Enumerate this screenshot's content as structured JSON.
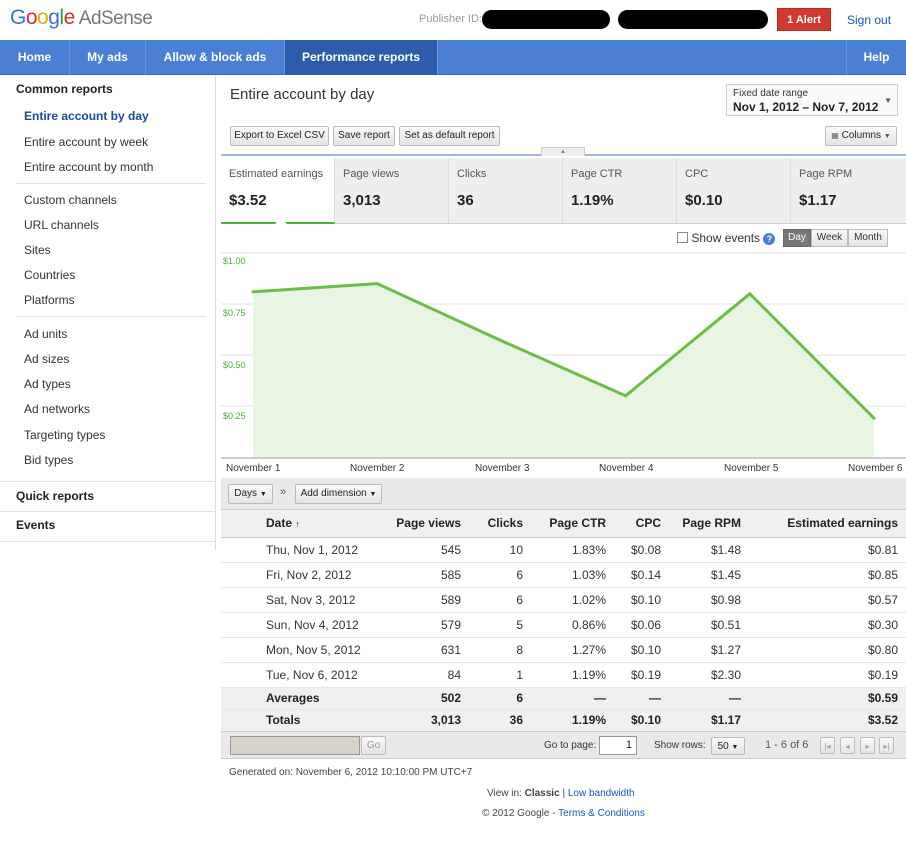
{
  "header": {
    "logo_letters": [
      "G",
      "o",
      "o",
      "g",
      "l",
      "e"
    ],
    "product": "AdSense",
    "publisher_label": "Publisher ID:",
    "alert_label": "1 Alert",
    "signout_label": "Sign out"
  },
  "nav": {
    "items": [
      {
        "label": "Home"
      },
      {
        "label": "My ads"
      },
      {
        "label": "Allow & block ads"
      },
      {
        "label": "Performance reports"
      }
    ],
    "help_label": "Help"
  },
  "sidebar": {
    "common_heading": "Common reports",
    "common_items": [
      "Entire account by day",
      "Entire account by week",
      "Entire account by month"
    ],
    "group2": [
      "Custom channels",
      "URL channels",
      "Sites",
      "Countries",
      "Platforms"
    ],
    "group3": [
      "Ad units",
      "Ad sizes",
      "Ad types",
      "Ad networks",
      "Targeting types",
      "Bid types"
    ],
    "quick_reports": "Quick reports",
    "events": "Events"
  },
  "report": {
    "title": "Entire account by day",
    "date_range_label": "Fixed date range",
    "date_range_value": "Nov 1, 2012 – Nov 7, 2012",
    "buttons": {
      "export": "Export to Excel CSV",
      "save": "Save report",
      "default": "Set as default report",
      "columns": "Columns"
    }
  },
  "metrics": [
    {
      "label": "Estimated earnings",
      "value": "$3.52"
    },
    {
      "label": "Page views",
      "value": "3,013"
    },
    {
      "label": "Clicks",
      "value": "36"
    },
    {
      "label": "Page CTR",
      "value": "1.19%"
    },
    {
      "label": "CPC",
      "value": "$0.10"
    },
    {
      "label": "Page RPM",
      "value": "$1.17"
    }
  ],
  "chart_controls": {
    "show_events": "Show events",
    "help_icon": "?",
    "granularity": [
      "Day",
      "Week",
      "Month"
    ],
    "active_granularity": "Day"
  },
  "chart_data": {
    "type": "area",
    "x": [
      "November 1",
      "November 2",
      "November 3",
      "November 4",
      "November 5",
      "November 6"
    ],
    "y_ticks": [
      "$1.00",
      "$0.75",
      "$0.50",
      "$0.25"
    ],
    "ylim": [
      0,
      1.0
    ],
    "series": [
      {
        "values": [
          0.81,
          0.85,
          0.57,
          0.3,
          0.8,
          0.19
        ]
      }
    ],
    "line_color": "#6cbd45",
    "fill_color": "#e9f5e3"
  },
  "dimension_bar": {
    "dimension": "Days",
    "separator": "»",
    "add_dimension": "Add dimension"
  },
  "table": {
    "columns": [
      "Date",
      "Page views",
      "Clicks",
      "Page CTR",
      "CPC",
      "Page RPM",
      "Estimated earnings"
    ],
    "sort_indicator": "↑",
    "rows": [
      [
        "Thu, Nov 1, 2012",
        "545",
        "10",
        "1.83%",
        "$0.08",
        "$1.48",
        "$0.81"
      ],
      [
        "Fri, Nov 2, 2012",
        "585",
        "6",
        "1.03%",
        "$0.14",
        "$1.45",
        "$0.85"
      ],
      [
        "Sat, Nov 3, 2012",
        "589",
        "6",
        "1.02%",
        "$0.10",
        "$0.98",
        "$0.57"
      ],
      [
        "Sun, Nov 4, 2012",
        "579",
        "5",
        "0.86%",
        "$0.06",
        "$0.51",
        "$0.30"
      ],
      [
        "Mon, Nov 5, 2012",
        "631",
        "8",
        "1.27%",
        "$0.10",
        "$1.27",
        "$0.80"
      ],
      [
        "Tue, Nov 6, 2012",
        "84",
        "1",
        "1.19%",
        "$0.19",
        "$2.30",
        "$0.19"
      ]
    ],
    "averages": [
      "Averages",
      "502",
      "6",
      "—",
      "—",
      "—",
      "$0.59"
    ],
    "totals": [
      "Totals",
      "3,013",
      "36",
      "1.19%",
      "$0.10",
      "$1.17",
      "$3.52"
    ]
  },
  "pagination": {
    "go_label": "Go",
    "go_to_page_label": "Go to page:",
    "page_value": "1",
    "show_rows_label": "Show rows:",
    "rows_value": "50",
    "range_label": "1 - 6 of 6"
  },
  "footer": {
    "generated": "Generated on: November 6, 2012 10:10:00 PM UTC+7",
    "view_in": "View in:",
    "classic": "Classic",
    "separator": "|",
    "low_bandwidth": "Low bandwidth",
    "copyright": "© 2012 Google -",
    "terms": "Terms & Conditions"
  }
}
